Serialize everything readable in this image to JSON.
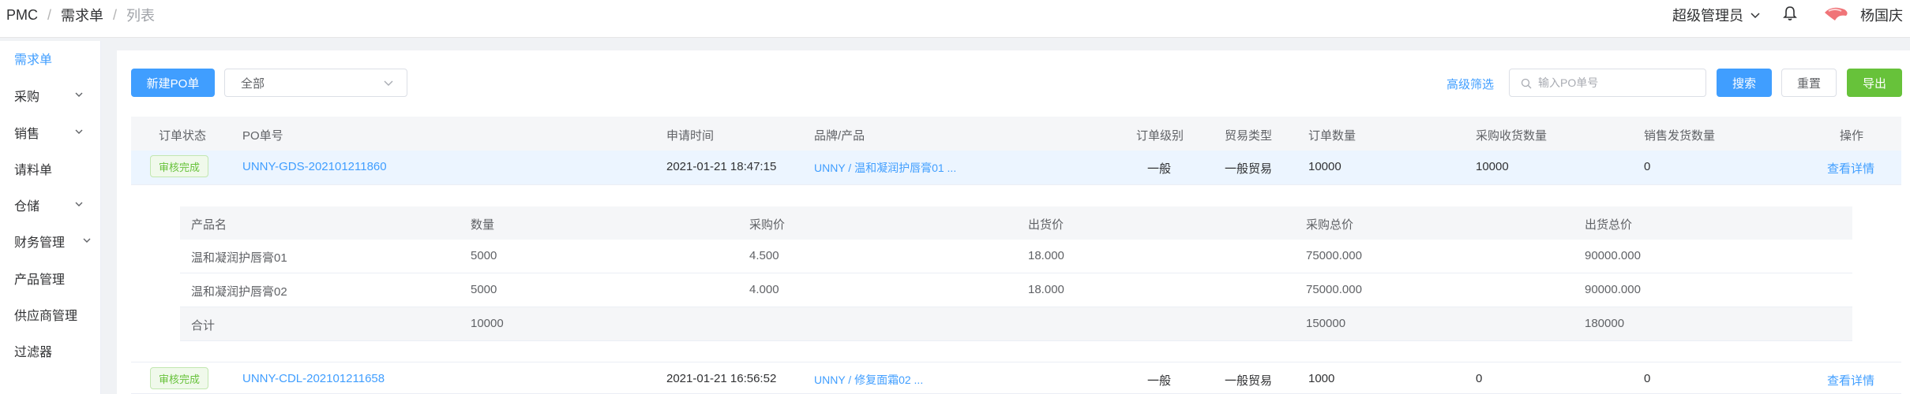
{
  "breadcrumb": {
    "root": "PMC",
    "parent": "需求单",
    "current": "列表",
    "separator": "/"
  },
  "header": {
    "role": "超级管理员",
    "username": "杨国庆"
  },
  "sidebar": {
    "items": [
      {
        "label": "需求单",
        "active": true,
        "expandable": false
      },
      {
        "label": "采购",
        "expandable": true
      },
      {
        "label": "销售",
        "expandable": true
      },
      {
        "label": "请料单",
        "expandable": false
      },
      {
        "label": "仓储",
        "expandable": true
      },
      {
        "label": "财务管理",
        "expandable": true
      },
      {
        "label": "产品管理",
        "expandable": false
      },
      {
        "label": "供应商管理",
        "expandable": false
      },
      {
        "label": "过滤器",
        "expandable": false
      }
    ]
  },
  "toolbar": {
    "new_po_label": "新建PO单",
    "filter_value": "全部",
    "advanced_filter": "高级筛选",
    "search_placeholder": "输入PO单号",
    "search_label": "搜索",
    "reset_label": "重置",
    "export_label": "导出"
  },
  "table": {
    "columns": [
      "订单状态",
      "PO单号",
      "申请时间",
      "品牌/产品",
      "订单级别",
      "贸易类型",
      "订单数量",
      "采购收货数量",
      "销售发货数量",
      "操作"
    ],
    "rows": [
      {
        "status": "审核完成",
        "po": "UNNY-GDS-202101211860",
        "time": "2021-01-21 18:47:15",
        "brand": "UNNY / 温和凝润护唇膏01 ...",
        "level": "一般",
        "trade": "一般贸易",
        "qty": "10000",
        "received": "10000",
        "shipped": "0",
        "action": "查看详情"
      },
      {
        "status": "审核完成",
        "po": "UNNY-CDL-202101211658",
        "time": "2021-01-21 16:56:52",
        "brand": "UNNY / 修复面霜02 ...",
        "level": "一般",
        "trade": "一般贸易",
        "qty": "1000",
        "received": "0",
        "shipped": "0",
        "action": "查看详情"
      }
    ]
  },
  "detail": {
    "columns": [
      "产品名",
      "数量",
      "采购价",
      "出货价",
      "采购总价",
      "出货总价"
    ],
    "rows": [
      [
        "温和凝润护唇膏01",
        "5000",
        "4.500",
        "18.000",
        "75000.000",
        "90000.000"
      ],
      [
        "温和凝润护唇膏02",
        "5000",
        "4.000",
        "18.000",
        "75000.000",
        "90000.000"
      ],
      [
        "合计",
        "10000",
        "",
        "",
        "150000",
        "180000"
      ]
    ]
  },
  "colors": {
    "primary": "#409eff",
    "success": "#67c23a",
    "highlight_row": "#ecf5ff"
  }
}
